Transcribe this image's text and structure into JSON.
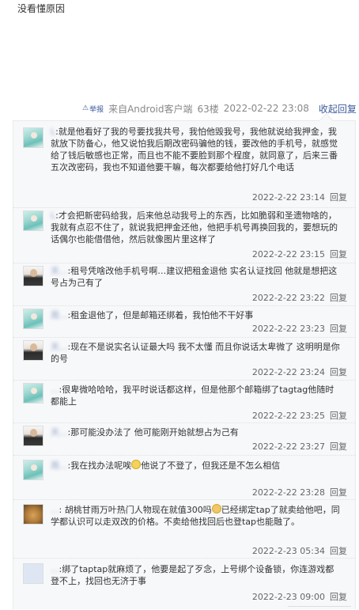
{
  "post": {
    "text": "没看懂原因"
  },
  "meta": {
    "report_label": "举报",
    "source": "来自Android客户端",
    "floor": "63楼",
    "time": "2022-02-22 23:08",
    "collapse_label": "收起回复"
  },
  "reply_label": "回复",
  "replies": [
    {
      "user": "L",
      "text": ":就是他看好了我的号要找我共号，我怕他毁我号，我他就说给我押金，我就放下防备心，他又说怕我后期改密码骗他的钱，要改他的手机号，就感觉给了钱后敏感也正常，而且也不能不要脸到那个程度，就同意了，后来三番五次改密码，我也不知道他要干嘛，每次都要给他打好几个电话",
      "time": "2022-2-22 23:14"
    },
    {
      "user": "L",
      "text": ":才会把新密码给我，后来他总动我号上的东西，比如脆弱和圣遗物啥的，我就有点忍不住了，就说我把押金还他，他把手机号再换回我的，要想玩的话偶尔也能借借他，然后就像图片里这样了",
      "time": "2022-2-22 23:15"
    },
    {
      "user": "天...",
      "text": ":租号凭啥改他手机号啊…建议把租金退他 实名认证找回 他就是想把这号占为己有了",
      "time": "2022-2-22 23:22"
    },
    {
      "user": "周...",
      "text": ":租金退他了，但是邮箱还绑着，我怕他不干好事",
      "time": "2022-2-22 23:23"
    },
    {
      "user": "天...",
      "text": ":现在不是说实名认证最大吗 我不太懂 而且你说话太卑微了 这明明是你的号",
      "time": "2022-2-22 23:24"
    },
    {
      "user": "...",
      "text": ":很卑微哈哈哈，我平时说话都这样，但是他那个邮箱绑了tagtag他随时都能上",
      "time": "2022-2-22 23:25"
    },
    {
      "user": "天...",
      "text": ":那可能没办法了 他可能刚开始就想占为己有",
      "time": "2022-2-22 23:27"
    },
    {
      "user": "周...",
      "text_a": ":我在找办法呢唉",
      "text_b": "他说了不登了，但我还是不怎么相信",
      "time": "2022-2-22 23:28"
    },
    {
      "user": "...",
      "text_a": ": 胡桃甘雨万叶热门人物现在就值300吗",
      "text_b": "已经绑定tap了就卖给他吧，同学都认识可以走双改的价格。不卖给他找回后也登tap也能融了。",
      "time": "2022-2-23 05:34"
    },
    {
      "user": "...",
      "text": ":绑了taptap就麻烦了，他要是起了歹念，上号绑个设备锁，你连游戏都登不上，找回也无济于事",
      "time": "2022-2-23 09:00"
    }
  ]
}
